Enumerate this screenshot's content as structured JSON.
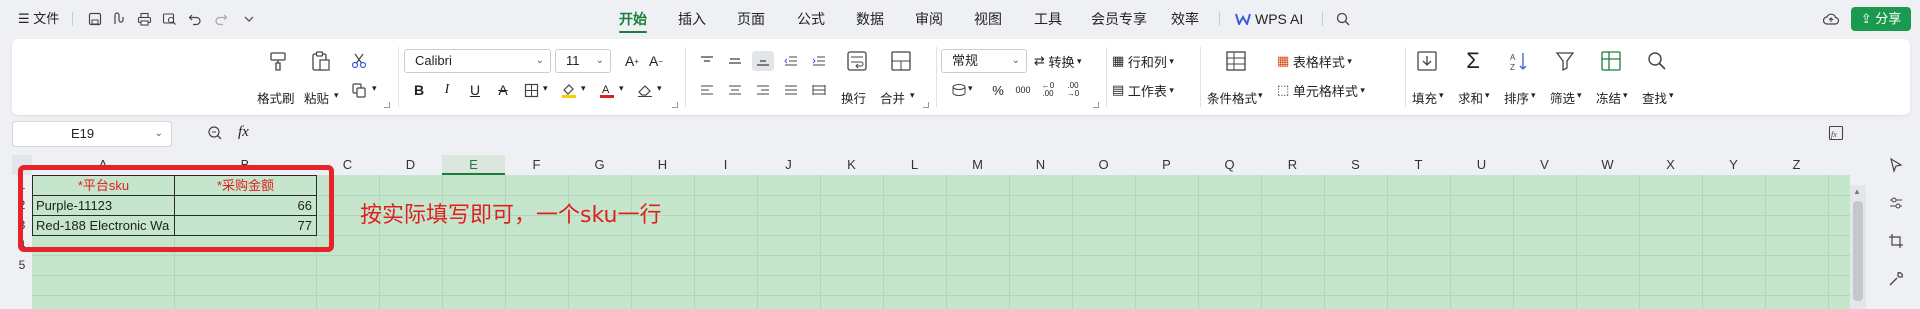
{
  "menubar": {
    "file_label": "文件",
    "tabs": [
      {
        "label": "开始",
        "active": true
      },
      {
        "label": "插入",
        "active": false
      },
      {
        "label": "页面",
        "active": false
      },
      {
        "label": "公式",
        "active": false
      },
      {
        "label": "数据",
        "active": false
      },
      {
        "label": "审阅",
        "active": false
      },
      {
        "label": "视图",
        "active": false
      },
      {
        "label": "工具",
        "active": false
      },
      {
        "label": "会员专享",
        "active": false
      },
      {
        "label": "效率",
        "active": false
      }
    ],
    "wps_ai_label": "WPS AI",
    "share_label": "分享",
    "accent_color": "#1a7f3c"
  },
  "ribbon": {
    "format_painter": "格式刷",
    "paste": "粘贴",
    "font_name": "Calibri",
    "font_size": "11",
    "wrap_text": "换行",
    "merge": "合并",
    "number_format": "常规",
    "convert": "转换",
    "row_col": "行和列",
    "worksheet": "工作表",
    "conditional_format": "条件格式",
    "table_style": "表格样式",
    "cell_style": "单元格样式",
    "fill": "填充",
    "sum": "求和",
    "sort": "排序",
    "filter": "筛选",
    "freeze": "冻结",
    "find": "查找"
  },
  "formula_bar": {
    "name_box": "E19",
    "fx_label": "fx",
    "formula": ""
  },
  "sheet": {
    "columns": [
      "A",
      "B",
      "C",
      "D",
      "E",
      "F",
      "G",
      "H",
      "I",
      "J",
      "K",
      "L",
      "M",
      "N",
      "O",
      "P",
      "Q",
      "R",
      "S",
      "T",
      "U",
      "V",
      "W",
      "X",
      "Y",
      "Z"
    ],
    "selected_column": "E",
    "rows": [
      "1",
      "2",
      "3",
      "4",
      "5"
    ],
    "header_a": "*平台sku",
    "header_b": "*采购金额",
    "row2_a": "Purple-11123",
    "row2_b": "66",
    "row3_a": "Red-188 Electronic Wa",
    "row3_b": "77",
    "annotation": "按实际填写即可，一个sku一行",
    "grid_color": "#c6e5cd",
    "annotation_color": "#e02020"
  }
}
